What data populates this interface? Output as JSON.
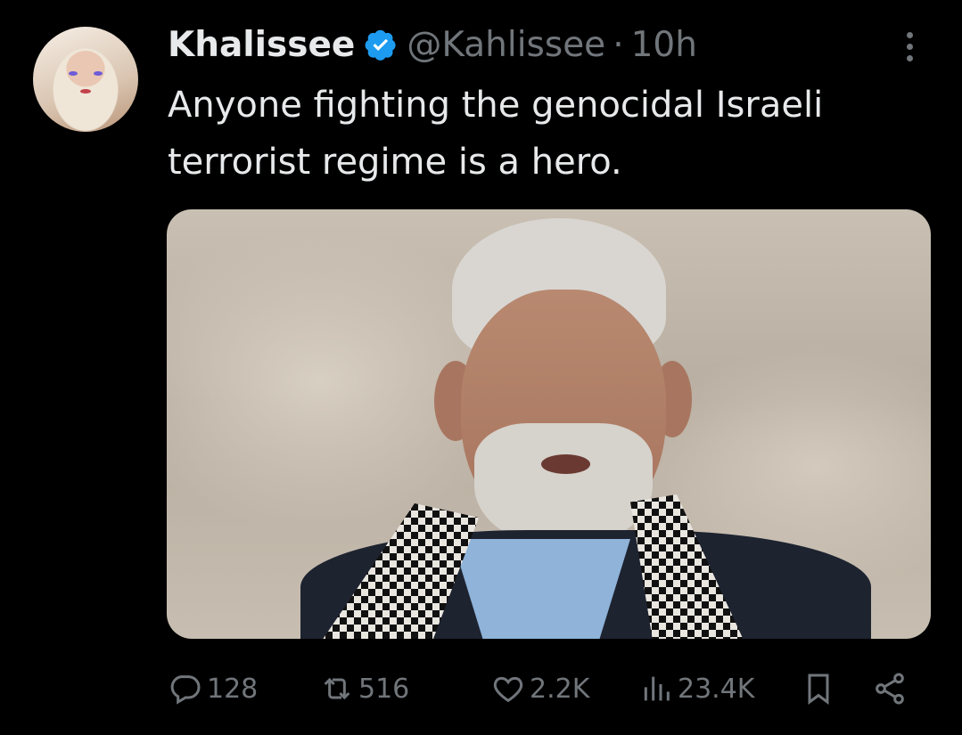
{
  "tweet": {
    "display_name": "Khalissee",
    "handle": "@Kahlissee",
    "separator": "·",
    "time": "10h",
    "text": "Anyone fighting the genocidal Israeli terrorist regime is a hero.",
    "verified_color": "#1d9bf0",
    "media_alt": ""
  },
  "actions": {
    "replies": "128",
    "reposts": "516",
    "likes": "2.2K",
    "views": "23.4K"
  },
  "icons": [
    "verified-badge-icon",
    "more-icon",
    "reply-icon",
    "repost-icon",
    "like-icon",
    "views-icon",
    "bookmark-icon",
    "share-icon"
  ]
}
